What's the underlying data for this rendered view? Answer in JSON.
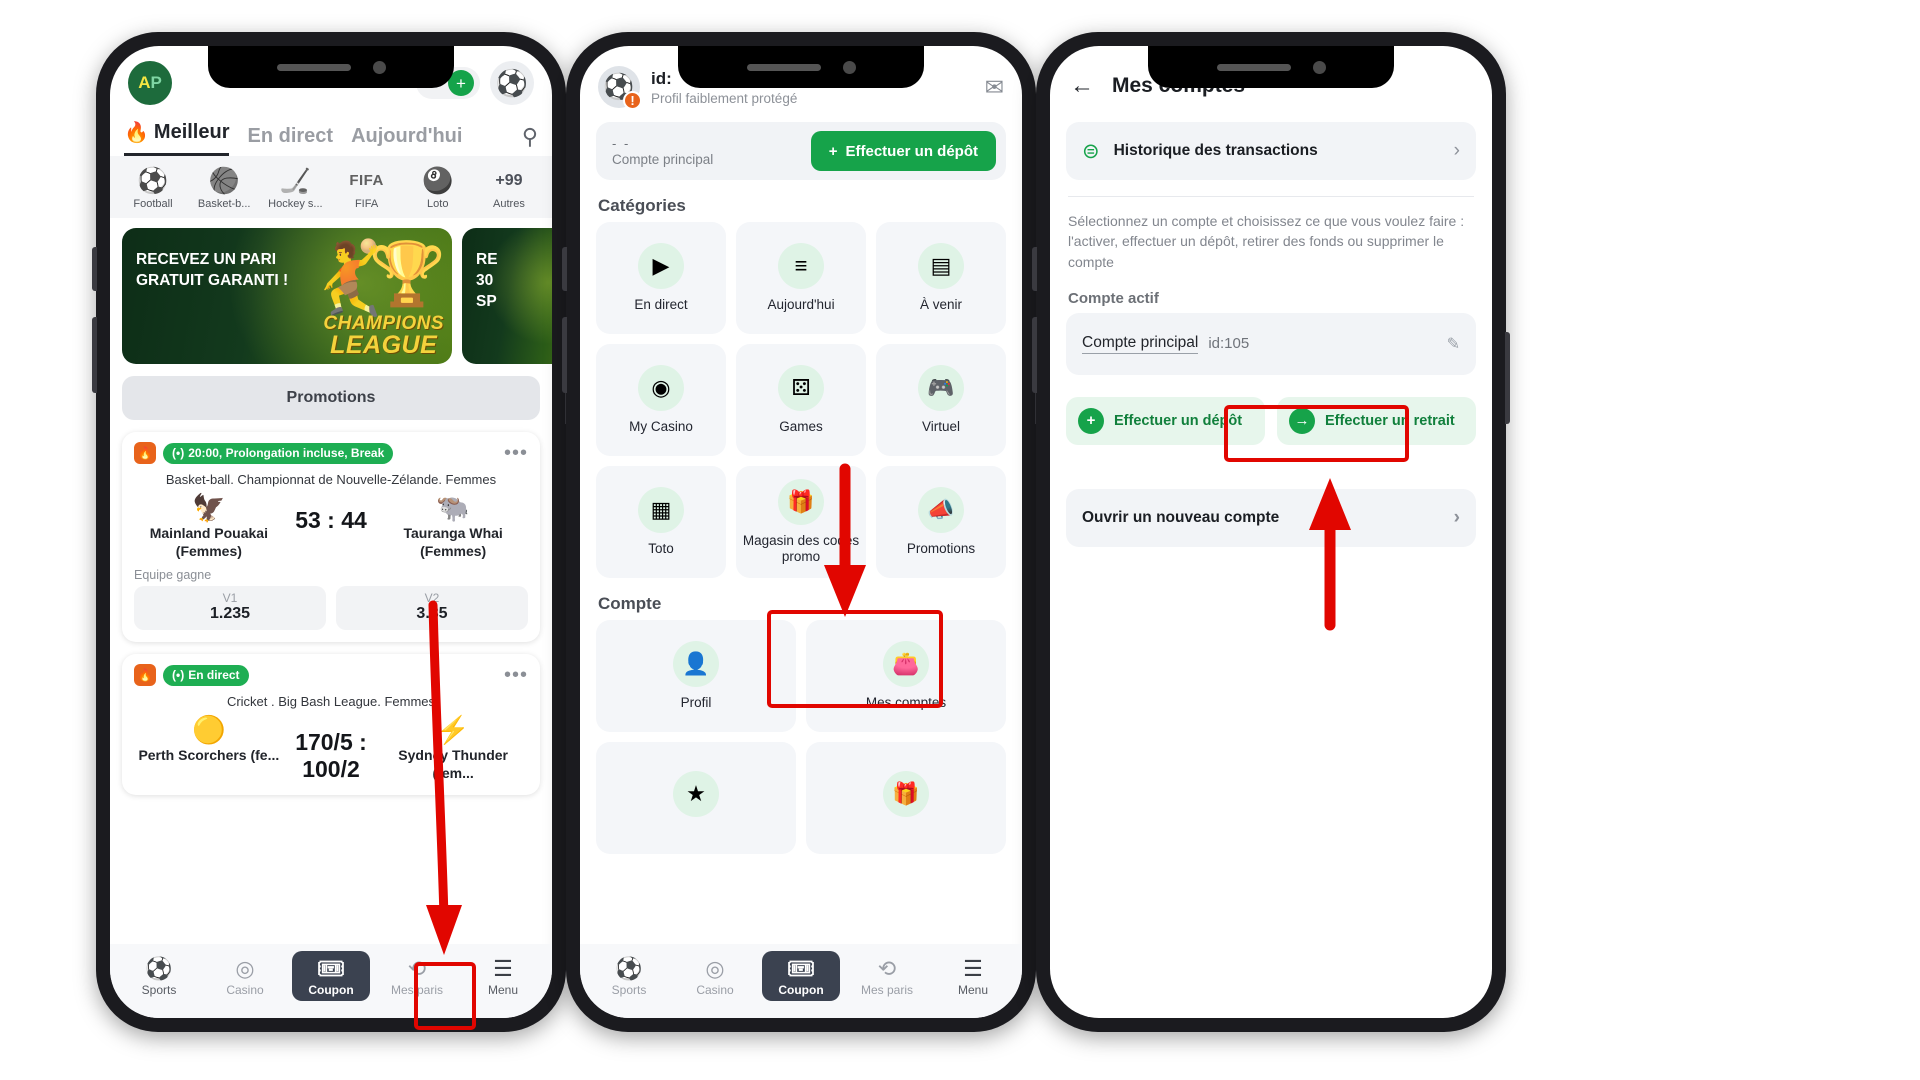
{
  "colors": {
    "brand_green": "#16a34a",
    "live_green": "#1eae53",
    "fire_orange": "#e8631b",
    "dark_nav": "#3b4250",
    "annotation_red": "#e10600"
  },
  "phone1": {
    "name": "sports-home-screen",
    "avatar_initials": {
      "a": "A",
      "p": "P"
    },
    "balance": "- -",
    "tabs": [
      {
        "label": "Meilleur",
        "icon": "fire-icon",
        "active": true
      },
      {
        "label": "En direct",
        "icon": "",
        "active": false
      },
      {
        "label": "Aujourd'hui",
        "icon": "",
        "active": false
      }
    ],
    "search_icon": "search-icon",
    "sports": [
      {
        "label": "Football",
        "icon": "soccer-ball-icon"
      },
      {
        "label": "Basket-b...",
        "icon": "basketball-icon"
      },
      {
        "label": "Hockey s...",
        "icon": "hockey-puck-icon"
      },
      {
        "label": "FIFA",
        "icon": "fifa-icon"
      },
      {
        "label": "Loto",
        "icon": "loto-icon"
      },
      {
        "label": "Autres",
        "icon": "plus-99",
        "count": "+99"
      }
    ],
    "banner": {
      "line1": "RECEVEZ UN PARI",
      "line2": "GRATUIT GARANTI !",
      "logo_line1": "CHAMPIONS",
      "logo_line2": "LEAGUE"
    },
    "banner2": {
      "line1": "RE",
      "line2": "30",
      "line3": "SP"
    },
    "promotions_label": "Promotions",
    "matches": [
      {
        "status": "20:00, Prolongation incluse, Break",
        "league": "Basket-ball. Championnat de Nouvelle-Zélande. Femmes",
        "home": "Mainland Pouakai (Femmes)",
        "away": "Tauranga Whai (Femmes)",
        "score": "53 : 44",
        "market": "Equipe gagne",
        "odds": [
          {
            "label": "V1",
            "value": "1.235"
          },
          {
            "label": "V2",
            "value": "3.85"
          }
        ]
      },
      {
        "status": "En direct",
        "league": "Cricket . Big Bash League. Femmes",
        "home": "Perth Scorchers (fe...",
        "away": "Sydney Thunder (fem...",
        "score": "170/5 : 100/2"
      }
    ],
    "bottomnav": [
      {
        "label": "Sports",
        "icon": "soccer-ball-icon",
        "state": "normal"
      },
      {
        "label": "Casino",
        "icon": "casino-chip-icon",
        "state": "dim"
      },
      {
        "label": "Coupon",
        "icon": "ticket-icon",
        "state": "active"
      },
      {
        "label": "Mes paris",
        "icon": "history-clock-icon",
        "state": "dim"
      },
      {
        "label": "Menu",
        "icon": "hamburger-icon",
        "state": "normal"
      }
    ]
  },
  "phone2": {
    "name": "menu-screen",
    "user_id": "id:",
    "profile_status": "Profil faiblement protégé",
    "mail_icon": "envelope-icon",
    "balance_amount": "- -",
    "balance_label": "Compte principal",
    "deposit_button": "Effectuer un dépôt",
    "categories_title": "Catégories",
    "categories": [
      {
        "label": "En direct",
        "icon": "live-play-icon"
      },
      {
        "label": "Aujourd'hui",
        "icon": "lines-icon"
      },
      {
        "label": "À venir",
        "icon": "calendar-icon"
      },
      {
        "label": "My Casino",
        "icon": "coin-icon"
      },
      {
        "label": "Games",
        "icon": "dice-icon"
      },
      {
        "label": "Virtuel",
        "icon": "virtual-icon"
      },
      {
        "label": "Toto",
        "icon": "toto-icon"
      },
      {
        "label": "Magasin des codes promo",
        "icon": "gift-icon"
      },
      {
        "label": "Promotions",
        "icon": "megaphone-icon"
      }
    ],
    "account_title": "Compte",
    "account_items": [
      {
        "label": "Profil",
        "icon": "person-icon"
      },
      {
        "label": "Mes comptes",
        "icon": "wallet-icon"
      },
      {
        "label": "",
        "icon": "star-icon"
      },
      {
        "label": "",
        "icon": "gift-icon"
      }
    ],
    "bottomnav": [
      {
        "label": "Sports",
        "icon": "soccer-ball-icon",
        "state": "dim"
      },
      {
        "label": "Casino",
        "icon": "casino-chip-icon",
        "state": "dim"
      },
      {
        "label": "Coupon",
        "icon": "ticket-icon",
        "state": "active"
      },
      {
        "label": "Mes paris",
        "icon": "history-clock-icon",
        "state": "dim"
      },
      {
        "label": "Menu",
        "icon": "hamburger-icon",
        "state": "normal"
      }
    ]
  },
  "phone3": {
    "name": "my-accounts-screen",
    "back_icon": "arrow-left-icon",
    "title": "Mes comptes",
    "history_row": {
      "label": "Historique des transactions",
      "icon": "transaction-history-icon",
      "chevron": "chevron-right-icon"
    },
    "description": "Sélectionnez un compte et choisissez ce que vous voulez faire : l'activer, effectuer un dépôt, retirer des fonds ou supprimer le compte",
    "active_account_label": "Compte actif",
    "account_name": "Compte principal",
    "account_id": "id:105",
    "edit_icon": "pencil-icon",
    "actions": [
      {
        "label": "Effectuer un dépôt",
        "icon": "plus-circle-icon"
      },
      {
        "label": "Effectuer un retrait",
        "icon": "arrow-right-circle-icon"
      }
    ],
    "new_account": {
      "label": "Ouvrir un nouveau compte",
      "chevron": "chevron-right-icon"
    }
  },
  "annotations": [
    {
      "name": "highlight-menu-tab",
      "target": "phone1 Menu nav button"
    },
    {
      "name": "arrow-to-menu-tab",
      "target": "points down to Menu"
    },
    {
      "name": "highlight-mes-comptes",
      "target": "phone2 Mes comptes tile"
    },
    {
      "name": "arrow-to-mes-comptes",
      "target": "points down to Mes comptes"
    },
    {
      "name": "highlight-effectuer-retrait",
      "target": "phone3 Effectuer un retrait button"
    },
    {
      "name": "arrow-to-effectuer-retrait",
      "target": "points up to Effectuer un retrait"
    }
  ]
}
